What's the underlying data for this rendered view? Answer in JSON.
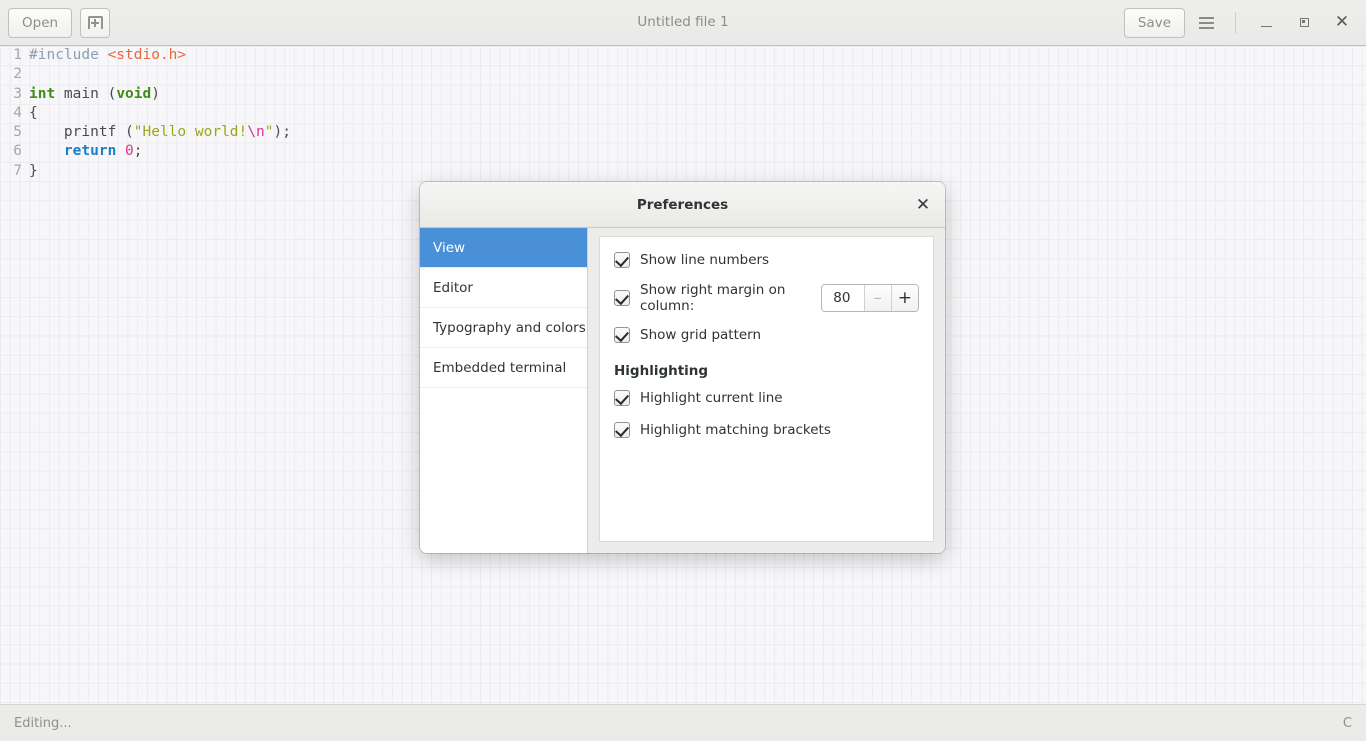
{
  "window": {
    "title": "Untitled file 1",
    "toolbar": {
      "open_label": "Open",
      "new_doc_icon": "new-document-icon",
      "save_label": "Save",
      "menu_icon": "hamburger-menu-icon",
      "minimize_icon": "minimize-icon",
      "maximize_icon": "maximize-icon",
      "close_icon": "close-icon"
    }
  },
  "editor": {
    "lines": [
      {
        "number": "1",
        "tokens": [
          {
            "cls": "c-pre",
            "text": "#include"
          },
          {
            "cls": "c-plain",
            "text": " "
          },
          {
            "cls": "c-inc",
            "text": "<stdio.h>"
          }
        ]
      },
      {
        "number": "2",
        "tokens": []
      },
      {
        "number": "3",
        "tokens": [
          {
            "cls": "c-type",
            "text": "int"
          },
          {
            "cls": "c-plain",
            "text": " main ("
          },
          {
            "cls": "c-type",
            "text": "void"
          },
          {
            "cls": "c-plain",
            "text": ")"
          }
        ]
      },
      {
        "number": "4",
        "tokens": [
          {
            "cls": "c-plain",
            "text": "{"
          }
        ]
      },
      {
        "number": "5",
        "tokens": [
          {
            "cls": "c-plain",
            "text": "    printf ("
          },
          {
            "cls": "c-str",
            "text": "\"Hello world!"
          },
          {
            "cls": "c-esc",
            "text": "\\n"
          },
          {
            "cls": "c-str",
            "text": "\""
          },
          {
            "cls": "c-plain",
            "text": ");"
          }
        ]
      },
      {
        "number": "6",
        "tokens": [
          {
            "cls": "c-plain",
            "text": "    "
          },
          {
            "cls": "c-kw",
            "text": "return"
          },
          {
            "cls": "c-plain",
            "text": " "
          },
          {
            "cls": "c-num",
            "text": "0"
          },
          {
            "cls": "c-plain",
            "text": ";"
          }
        ]
      },
      {
        "number": "7",
        "tokens": [
          {
            "cls": "c-plain",
            "text": "}"
          }
        ]
      }
    ]
  },
  "statusbar": {
    "left": "Editing...",
    "right": "C"
  },
  "dialog": {
    "title": "Preferences",
    "close_icon": "close-icon",
    "sidebar": {
      "items": [
        {
          "label": "View",
          "selected": true
        },
        {
          "label": "Editor",
          "selected": false
        },
        {
          "label": "Typography and colors",
          "selected": false
        },
        {
          "label": "Embedded terminal",
          "selected": false
        }
      ]
    },
    "panel": {
      "options": [
        {
          "label": "Show line numbers",
          "checked": true
        },
        {
          "label": "Show right margin on column:",
          "checked": true
        },
        {
          "label": "Show grid pattern",
          "checked": true
        }
      ],
      "spinner": {
        "value": "80",
        "decrement_label": "–",
        "increment_label": "+"
      },
      "section_title": "Highlighting",
      "highlight_options": [
        {
          "label": "Highlight current line",
          "checked": true
        },
        {
          "label": "Highlight matching brackets",
          "checked": true
        }
      ]
    }
  },
  "colors": {
    "accent": "#4a90d9",
    "header_bg": "#eeeeec",
    "editor_bg": "#f7f7f9",
    "grid_line": "#ebebf0"
  }
}
